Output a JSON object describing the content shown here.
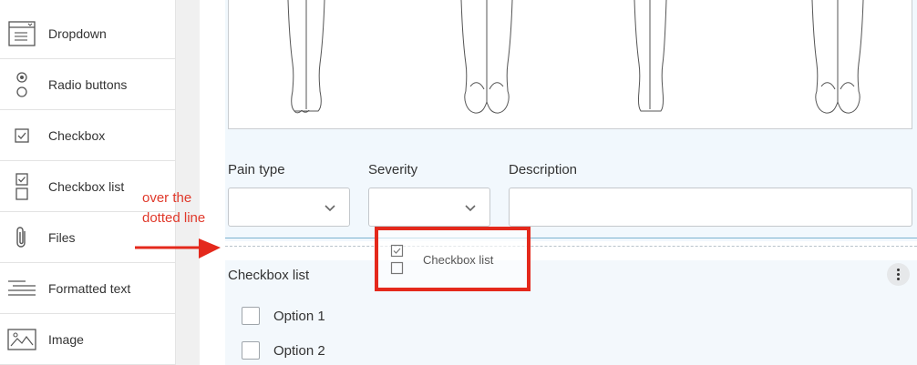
{
  "sidebar": {
    "items": [
      {
        "label": "Dropdown",
        "icon": "dropdown-icon"
      },
      {
        "label": "Radio buttons",
        "icon": "radio-buttons-icon"
      },
      {
        "label": "Checkbox",
        "icon": "checkbox-icon"
      },
      {
        "label": "Checkbox list",
        "icon": "checkbox-list-icon"
      },
      {
        "label": "Files",
        "icon": "paperclip-icon"
      },
      {
        "label": "Formatted text",
        "icon": "formatted-text-icon"
      },
      {
        "label": "Image",
        "icon": "image-icon"
      }
    ]
  },
  "form": {
    "pain_type_label": "Pain type",
    "severity_label": "Severity",
    "description_label": "Description",
    "pain_type_value": "",
    "severity_value": "",
    "description_value": "",
    "checkbox_list": {
      "title": "Checkbox list",
      "options": [
        "Option 1",
        "Option 2"
      ]
    }
  },
  "drag_ghost": {
    "label": "Checkbox list"
  },
  "annotation": {
    "line1": "over the",
    "line2": "dotted line"
  },
  "colors": {
    "accent": "#e4291c",
    "drop_line": "#7cb3d0",
    "band": "#f2f8fd"
  }
}
